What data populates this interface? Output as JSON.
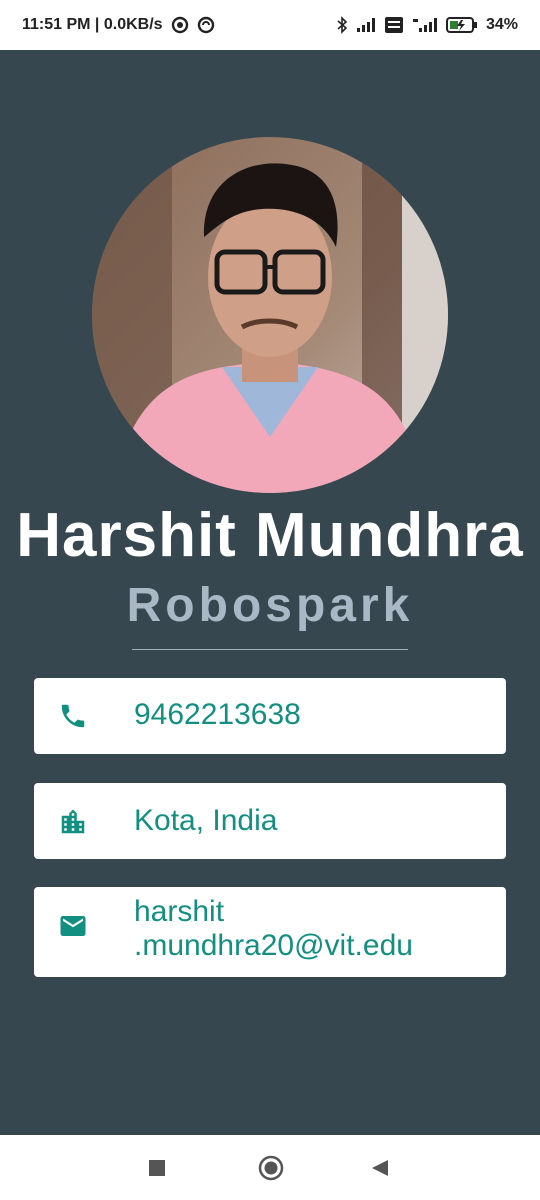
{
  "status_bar": {
    "time_and_speed": "11:51 PM | 0.0KB/s",
    "battery_percent": "34%"
  },
  "profile": {
    "name": "Harshit Mundhra",
    "company": "Robospark"
  },
  "contacts": {
    "phone": "9462213638",
    "location": "Kota, India",
    "email_line1": "harshit",
    "email_line2": ".mundhra20@vit.edu"
  },
  "colors": {
    "background": "#37474f",
    "accent": "#138f82",
    "subtitle": "#a9b8c4"
  },
  "icons": {
    "phone": "phone-icon",
    "location": "building-icon",
    "email": "mail-icon",
    "nav_recents": "square-icon",
    "nav_home": "circle-icon",
    "nav_back": "triangle-back-icon"
  }
}
